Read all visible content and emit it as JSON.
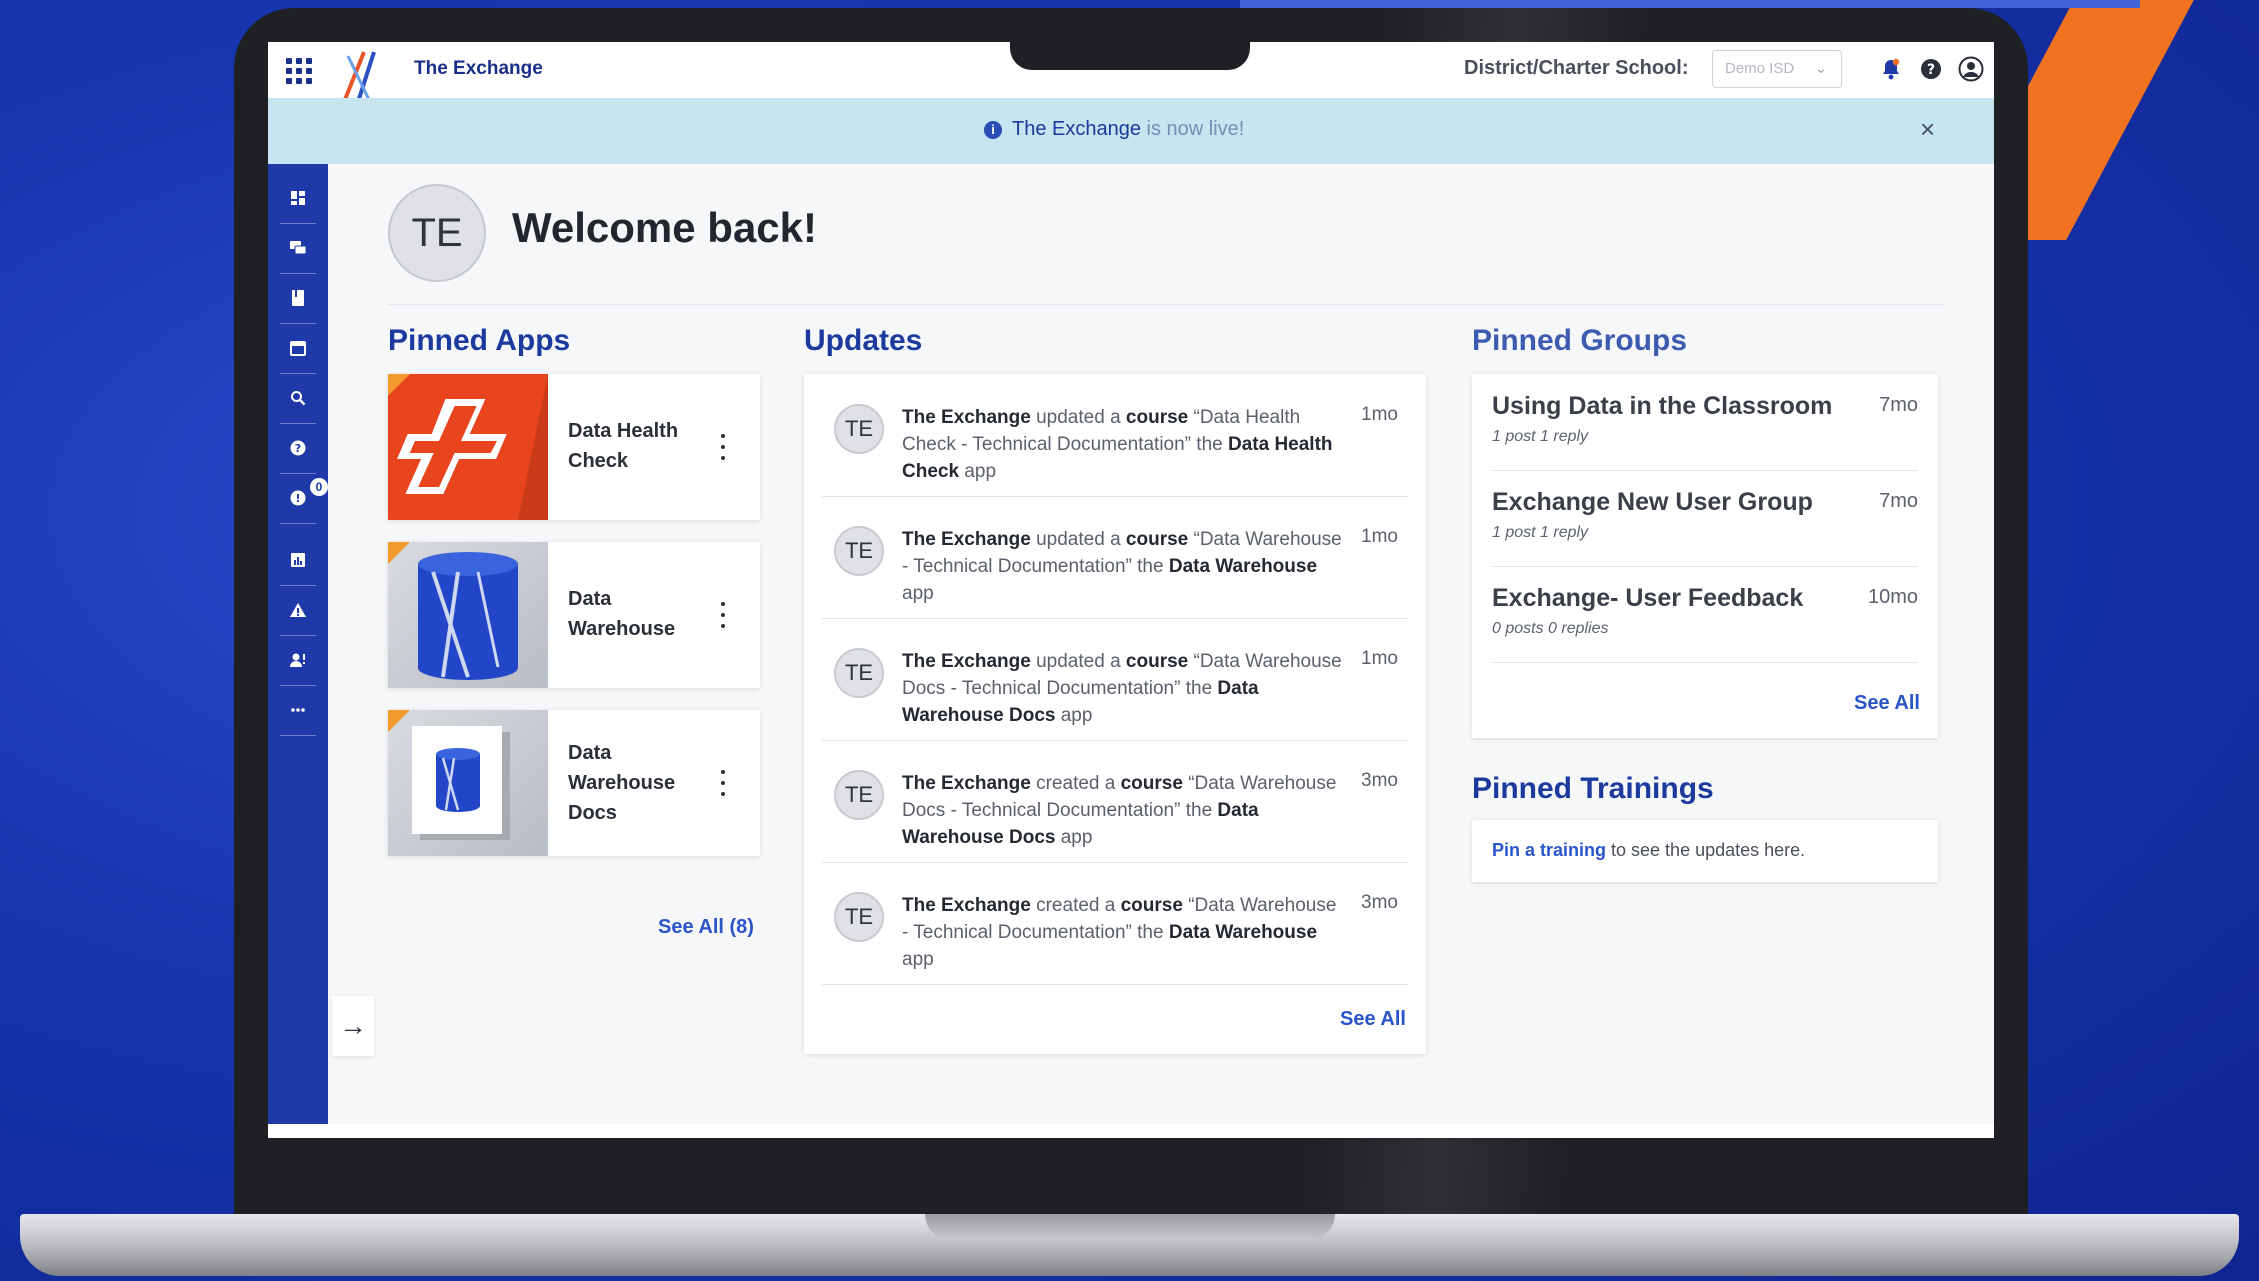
{
  "app": {
    "title": "The Exchange",
    "district_label": "District/Charter School:",
    "district_value": "Demo ISD",
    "brand_color": "#1f3aa8",
    "accent_color": "#2a55c8"
  },
  "banner": {
    "highlight": "The Exchange",
    "rest": " is now live!"
  },
  "user": {
    "initials": "TE",
    "welcome": "Welcome back!"
  },
  "sidebar": {
    "icons": [
      "dashboard-icon",
      "chat-icon",
      "book-icon",
      "calendar-icon",
      "search-icon",
      "help-icon",
      "notification-icon",
      "chart-icon",
      "alert-icon",
      "user-alert-icon",
      "more-icon"
    ],
    "badge_count": "0"
  },
  "pinned_apps": {
    "title": "Pinned Apps",
    "items": [
      {
        "name_line1": "Data Health",
        "name_line2": "Check",
        "name_line3": ""
      },
      {
        "name_line1": "Data",
        "name_line2": "Warehouse",
        "name_line3": ""
      },
      {
        "name_line1": "Data",
        "name_line2": "Warehouse",
        "name_line3": "Docs"
      }
    ],
    "see_all": "See All (8)"
  },
  "updates": {
    "title": "Updates",
    "items": [
      {
        "initials": "TE",
        "actor": "The Exchange",
        "verb": " updated a ",
        "obj": "course",
        "desc": " “Data Health Check - Technical Documentation” the ",
        "app": "Data Health Check",
        "suffix": " app",
        "time": "1mo"
      },
      {
        "initials": "TE",
        "actor": "The Exchange",
        "verb": " updated a ",
        "obj": "course",
        "desc": " “Data Warehouse - Technical Documentation” the ",
        "app": "Data Warehouse",
        "suffix": " app",
        "time": "1mo"
      },
      {
        "initials": "TE",
        "actor": "The Exchange",
        "verb": " updated a ",
        "obj": "course",
        "desc": " “Data Warehouse Docs - Technical Documentation” the ",
        "app": "Data Warehouse Docs",
        "suffix": " app",
        "time": "1mo"
      },
      {
        "initials": "TE",
        "actor": "The Exchange",
        "verb": " created a ",
        "obj": "course",
        "desc": " “Data Warehouse Docs - Technical Documentation” the ",
        "app": "Data Warehouse Docs",
        "suffix": " app",
        "time": "3mo"
      },
      {
        "initials": "TE",
        "actor": "The Exchange",
        "verb": " created a ",
        "obj": "course",
        "desc": " “Data Warehouse - Technical Documentation” the ",
        "app": "Data Warehouse",
        "suffix": " app",
        "time": "3mo"
      }
    ],
    "see_all": "See All"
  },
  "pinned_groups": {
    "title": "Pinned Groups",
    "items": [
      {
        "name": "Using Data in the Classroom",
        "meta": "1 post  1 reply",
        "time": "7mo"
      },
      {
        "name": "Exchange New User Group",
        "meta": "1 post  1 reply",
        "time": "7mo"
      },
      {
        "name": "Exchange- User Feedback",
        "meta": "0 posts  0 replies",
        "time": "10mo"
      }
    ],
    "see_all": "See All"
  },
  "pinned_trainings": {
    "title": "Pinned Trainings",
    "link": "Pin a training",
    "text": " to see the updates here."
  }
}
